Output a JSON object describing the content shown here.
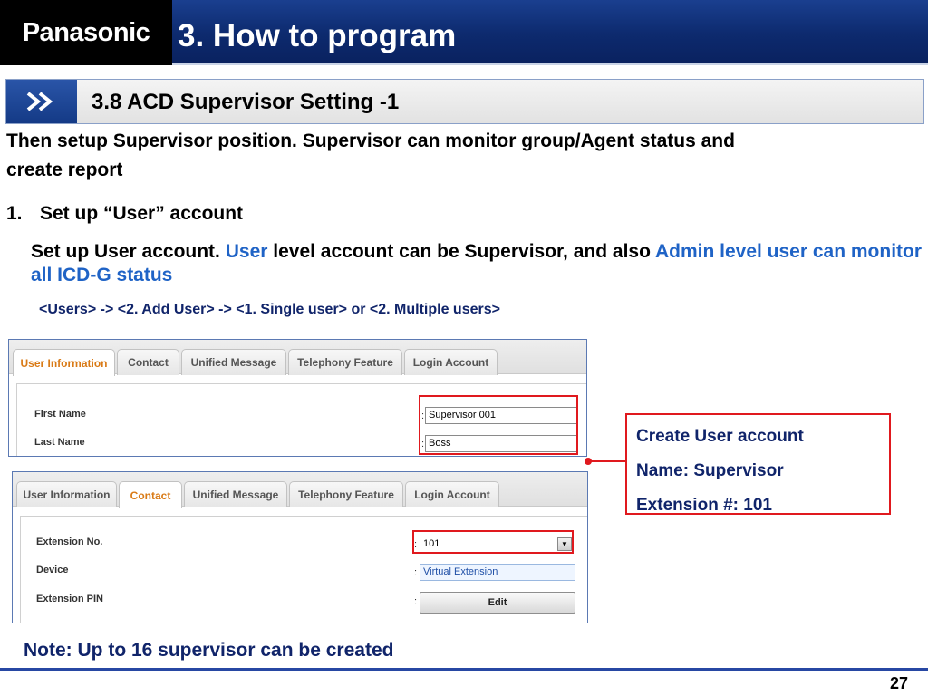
{
  "header": {
    "logo": "Panasonic",
    "title": "3. How to program"
  },
  "section": {
    "icon": "double-chevron-right-icon",
    "title": "3.8 ACD Supervisor Setting -1"
  },
  "intro": {
    "line1": "Then setup Supervisor position. Supervisor can monitor group/Agent status and",
    "line2": "create report"
  },
  "step": {
    "number": "1.",
    "text": "Set up “User” account"
  },
  "description": {
    "part1": "Set up User account. ",
    "highlight1": "User",
    "part2": " level account can be Supervisor, and also ",
    "highlight2": "Admin level user can monitor all ICD-G status"
  },
  "nav_path": "<Users> -> <2. Add User> -> <1. Single user> or <2. Multiple users>",
  "screenshot1": {
    "tabs": [
      "User Information",
      "Contact",
      "Unified Message",
      "Telephony Feature",
      "Login Account"
    ],
    "active_tab": "User Information",
    "fields": [
      {
        "label": "First Name",
        "value": "Supervisor 001"
      },
      {
        "label": "Last Name",
        "value": "Boss"
      }
    ]
  },
  "screenshot2": {
    "tabs": [
      "User Information",
      "Contact",
      "Unified Message",
      "Telephony Feature",
      "Login Account"
    ],
    "active_tab": "Contact",
    "fields": [
      {
        "label": "Extension No.",
        "value": "101"
      },
      {
        "label": "Device",
        "value": "Virtual Extension"
      },
      {
        "label": "Extension PIN",
        "button": "Edit"
      }
    ]
  },
  "callout": {
    "line1": "Create User account",
    "line2": "Name: Supervisor",
    "line3": "Extension #: 101"
  },
  "note": "Note: Up to 16 supervisor can be created",
  "page_number": "27",
  "colors": {
    "header_blue": "#0d2a6e",
    "accent_blue": "#1f63c6",
    "highlight_red": "#e0191e",
    "active_tab_orange": "#d97a16"
  }
}
